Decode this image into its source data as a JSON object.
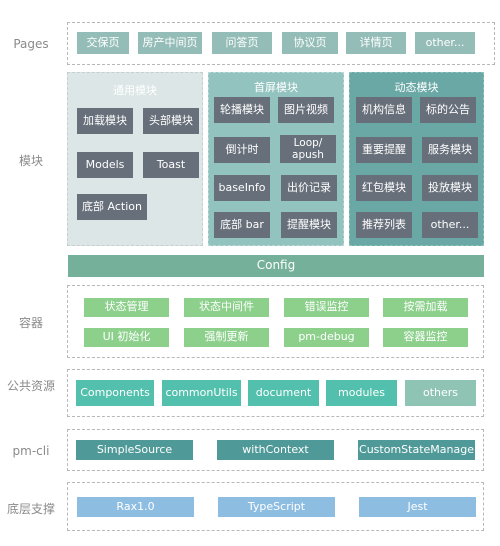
{
  "layers": {
    "pages": {
      "label": "Pages",
      "items": [
        "交保页",
        "房产中间页",
        "问答页",
        "协议页",
        "详情页",
        "other..."
      ]
    },
    "modules": {
      "label": "模块",
      "groups": [
        {
          "title": "通用模块",
          "items": [
            "加载模块",
            "头部模块",
            "Models",
            "Toast",
            "底部 Action"
          ]
        },
        {
          "title": "首屏模块",
          "items": [
            "轮播模块",
            "图片视频",
            "倒计时",
            "Loop/\napush",
            "baseInfo",
            "出价记录",
            "底部 bar",
            "提醒模块"
          ]
        },
        {
          "title": "动态模块",
          "items": [
            "机构信息",
            "标的公告",
            "重要提醒",
            "服务模块",
            "红包模块",
            "投放模块",
            "推荐列表",
            "other..."
          ]
        }
      ]
    },
    "config": {
      "label": "Config"
    },
    "container": {
      "label": "容器",
      "items": [
        "状态管理",
        "状态中间件",
        "错误监控",
        "按需加载",
        "UI 初始化",
        "强制更新",
        "pm-debug",
        "容器监控"
      ]
    },
    "public": {
      "label": "公共资源",
      "items": [
        "Components",
        "commonUtils",
        "document",
        "modules",
        "others"
      ]
    },
    "cli": {
      "label": "pm-cli",
      "items": [
        "SimpleSource",
        "withContext",
        "CustomStateManage"
      ]
    },
    "base": {
      "label": "底层支撑",
      "items": [
        "Rax1.0",
        "TypeScript",
        "Jest"
      ]
    }
  },
  "colors": {
    "page": "#94bdb8",
    "module_box": "#676f7a",
    "group_general": "#dce6e6",
    "group_first": "#93c3bf",
    "group_dynamic": "#6aa8a6",
    "config": "#74b09a",
    "container": "#8cd08c",
    "public": "#52c0ac",
    "public_dim": "#8fc4b4",
    "cli": "#4f9a98",
    "base": "#8ebde2"
  }
}
